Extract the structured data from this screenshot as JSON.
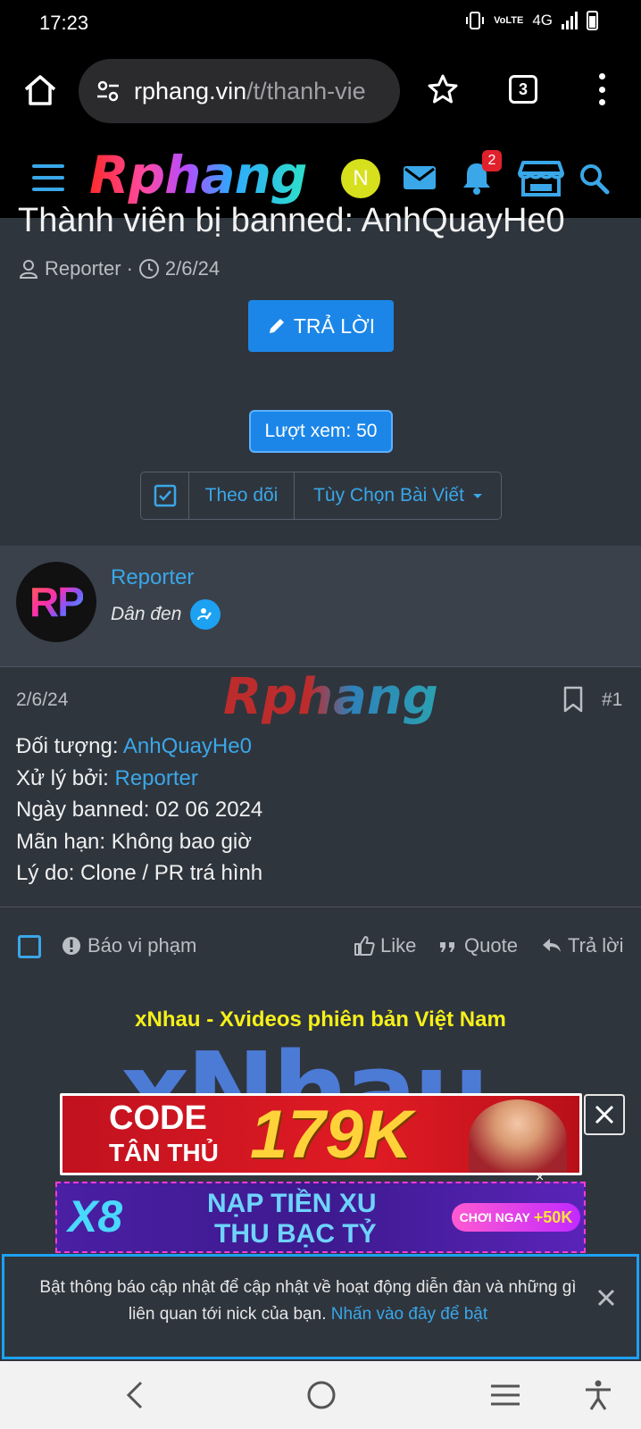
{
  "status": {
    "time": "17:23",
    "net": "4G",
    "volte": "VoLTE"
  },
  "browser": {
    "url_domain": "rphang.vin",
    "url_path": "/t/thanh-vie",
    "tab_count": "3"
  },
  "site": {
    "logo": "Rphang",
    "user_initial": "N",
    "notif_count": "2"
  },
  "thread": {
    "title": "Thành viên bị banned: AnhQuayHe0",
    "author": "Reporter",
    "separator": "·",
    "date": "2/6/24",
    "reply_button": "TRẢ LỜI",
    "views": "Lượt xem: 50",
    "follow": "Theo dõi",
    "options": "Tùy Chọn Bài Viết"
  },
  "post": {
    "user_name": "Reporter",
    "user_title": "Dân đen",
    "avatar_text": "RP",
    "date": "2/6/24",
    "number": "#1",
    "watermark": "Rphang",
    "target_label": "Đối tượng: ",
    "target_value": "AnhQuayHe0",
    "handled_label": "Xử lý bởi: ",
    "handled_value": "Reporter",
    "line_banned_date": "Ngày banned: 02 06 2024",
    "line_expiry": "Mãn hạn: Không bao giờ",
    "line_reason": "Lý do: Clone / PR trá hình",
    "report": "Báo vi phạm",
    "like": "Like",
    "quote": "Quote",
    "reply": "Trả lời"
  },
  "ads": {
    "title": "xNhau - Xvideos phiên bản Việt Nam",
    "brand": "xNhau",
    "banner1_line1": "CODE",
    "banner1_line2": "TÂN THỦ",
    "banner1_amount": "179K",
    "banner2_logo": "X8",
    "banner2_line1": "NẠP TIỀN XU",
    "banner2_line2": "THU BẠC TỶ",
    "banner2_cta": "CHƠI NGAY",
    "banner2_bonus": "+50K",
    "banner2_close": "×"
  },
  "notification": {
    "text": "Bật thông báo cập nhật để cập nhật về hoạt động diễn đàn và những gì liên quan tới nick của bạn. ",
    "link": "Nhấn vào đây để bật"
  },
  "colors": {
    "accent": "#3aa7e8",
    "button": "#1b86e8",
    "page_bg": "#2f353d",
    "badge": "#e0202c"
  },
  "icons": [
    "home-icon",
    "site-settings-icon",
    "star-icon",
    "tabs-icon",
    "more-icon",
    "hamburger-icon",
    "mail-icon",
    "bell-icon",
    "store-icon",
    "search-icon",
    "user-icon",
    "clock-icon",
    "pencil-icon",
    "checkbox-icon",
    "verified-icon",
    "bookmark-icon",
    "alert-icon",
    "like-icon",
    "quote-icon",
    "reply-icon",
    "close-icon",
    "back-icon",
    "home-nav-icon",
    "recents-icon",
    "accessibility-icon"
  ]
}
